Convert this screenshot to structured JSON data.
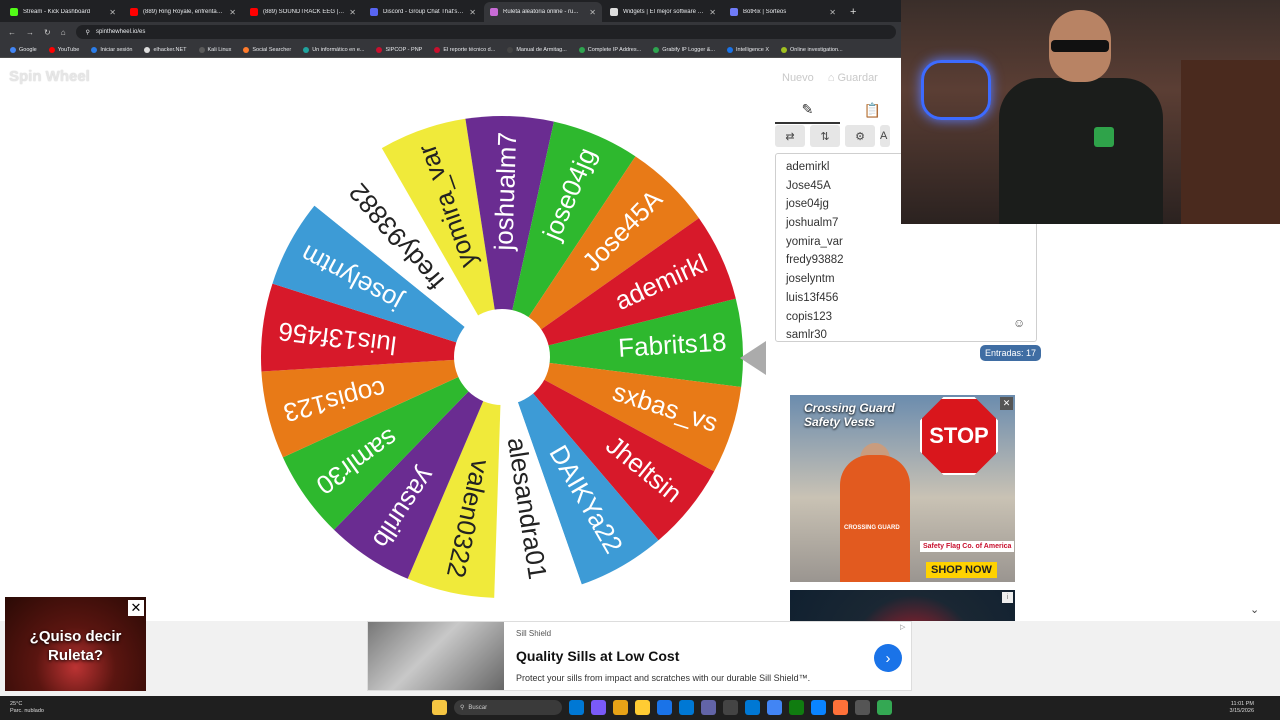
{
  "browser": {
    "tabs": [
      {
        "label": "Stream - Kick Dashboard",
        "color": "#53fc18",
        "active": false
      },
      {
        "label": "(889) Ring Royale, enfrentamie...",
        "color": "#ff0000",
        "active": false
      },
      {
        "label": "(889) SOUNDTRACK EEG | T...",
        "color": "#ff0000",
        "active": false
      },
      {
        "label": "Discord - Group Chat That's All...",
        "color": "#5865f2",
        "active": false
      },
      {
        "label": "Ruleta aleatoria online - ru...",
        "color": "#c86bd6",
        "active": true
      },
      {
        "label": "Widgets | El mejor software pa...",
        "color": "#dddddd",
        "active": false
      },
      {
        "label": "BotRix | Sorteos",
        "color": "#6f7bf7",
        "active": false
      }
    ],
    "url": "spinthewheel.io/es",
    "bookmarks": [
      {
        "label": "Google",
        "color": "#4285f4"
      },
      {
        "label": "YouTube",
        "color": "#ff0000"
      },
      {
        "label": "Iniciar sesión",
        "color": "#2b7de9"
      },
      {
        "label": "elhacker.NET",
        "color": "#dddddd"
      },
      {
        "label": "Kali Linux",
        "color": "#5a5a5a"
      },
      {
        "label": "Social Searcher",
        "color": "#ff7b2c"
      },
      {
        "label": "Un informático en e...",
        "color": "#20a39e"
      },
      {
        "label": "SIPCOP - PNP",
        "color": "#c8102e"
      },
      {
        "label": "El reporte técnico d...",
        "color": "#c8102e"
      },
      {
        "label": "Manual de Armitag...",
        "color": "#444444"
      },
      {
        "label": "Complete IP Addres...",
        "color": "#2ea44f"
      },
      {
        "label": "Grabify IP Logger &...",
        "color": "#2ea44f"
      },
      {
        "label": "Intelligence X",
        "color": "#1a73e8"
      },
      {
        "label": "Online investigation...",
        "color": "#a0c020"
      }
    ]
  },
  "app": {
    "logo": "Spin Wheel",
    "new_label": "Nuevo",
    "save_label": "⌂ Guardar",
    "panel_tab_edit_icon": "✎",
    "panel_tab_results_icon": "📋",
    "tool_shuffle": "⇄",
    "tool_sort": "⇅",
    "tool_settings": "⚙",
    "tool_more": "A",
    "count_label": "Entradas: 17",
    "emoji": "☺"
  },
  "entries": [
    "ademirkl",
    "Jose45A",
    "jose04jg",
    "joshualm7",
    "yomira_var",
    "fredy93882",
    "joselyntm",
    "luis13f456",
    "copis123",
    "samlr30"
  ],
  "wheel": {
    "segments": [
      {
        "label": "Fabrits18",
        "color": "#2eb82e"
      },
      {
        "label": "sxbas_vs",
        "color": "#e87a17"
      },
      {
        "label": "Jheltsin",
        "color": "#d7192a"
      },
      {
        "label": "DAIKYa22",
        "color": "#3d9bd6"
      },
      {
        "label": "alesandra01",
        "color": "#ffffff"
      },
      {
        "label": "valen0322",
        "color": "#f0ea3a"
      },
      {
        "label": "yasurilb",
        "color": "#6a2c91"
      },
      {
        "label": "samlr30",
        "color": "#2eb82e"
      },
      {
        "label": "copis123",
        "color": "#e87a17"
      },
      {
        "label": "luis13f456",
        "color": "#d7192a"
      },
      {
        "label": "joselyntm",
        "color": "#3d9bd6"
      },
      {
        "label": "fredy93882",
        "color": "#ffffff"
      },
      {
        "label": "yomira_var",
        "color": "#f0ea3a"
      },
      {
        "label": "joshualm7",
        "color": "#6a2c91"
      },
      {
        "label": "jose04jg",
        "color": "#2eb82e"
      },
      {
        "label": "Jose45A",
        "color": "#e87a17"
      },
      {
        "label": "ademirkl",
        "color": "#d7192a"
      }
    ]
  },
  "ads": {
    "crossing_title": "Crossing Guard Safety Vests",
    "crossing_stop": "STOP",
    "crossing_brand": "Safety Flag Co. of America",
    "crossing_cta": "SHOP NOW",
    "crossing_guard_text": "CROSSING GUARD",
    "banner_source": "Sill Shield",
    "banner_title": "Quality Sills at Low Cost",
    "banner_desc": "Protect your sills from impact and scratches with our durable Sill Shield™.",
    "video_text": "¿Quiso decir Ruleta?"
  },
  "taskbar": {
    "temp": "25°C",
    "weather": "Parc. nublado",
    "search_placeholder": "Buscar",
    "time": "11:01 PM",
    "date": "3/15/2026",
    "icon_colors": [
      "#f5c542",
      "#0078d4",
      "#7a5af8",
      "#e8a317",
      "#ffcc33",
      "#1a73e8",
      "#0078d4",
      "#6264a7",
      "#444444",
      "#0078d4",
      "#4285f4",
      "#107c10",
      "#0a84ff",
      "#ff7139",
      "#555555",
      "#34a853"
    ]
  }
}
